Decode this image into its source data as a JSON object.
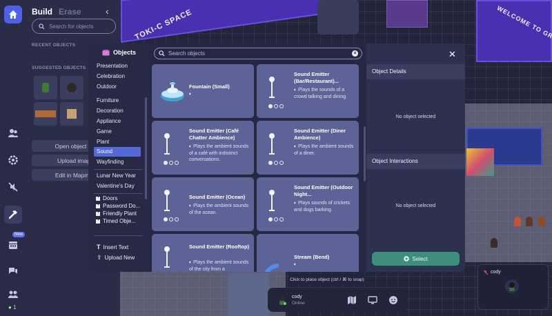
{
  "world": {
    "signs": [
      "TOKI-C SPACE",
      "WELCOME TO GROOVWORKS"
    ]
  },
  "build_panel": {
    "tabs": [
      "Build",
      "Erase"
    ],
    "search_placeholder": "Search for objects",
    "recent_heading": "RECENT OBJECTS",
    "suggested_heading": "SUGGESTED OBJECTS",
    "buttons": [
      "Open object pi",
      "Upload imag",
      "Edit in Mapma"
    ]
  },
  "rail": {
    "badge": "New",
    "online_count": "1"
  },
  "modal": {
    "title": "Objects",
    "search_placeholder": "Search objects",
    "categories": [
      "Presentation",
      "Celebration",
      "Outdoor",
      "Furniture",
      "Decoration",
      "Appliance",
      "Game",
      "Plant",
      "Sound",
      "Wayfinding",
      "Lunar New Year",
      "Valentine's Day"
    ],
    "active_category": "Sound",
    "subcategories": [
      "Doors",
      "Password Do...",
      "Friendly Plant",
      "Timed Obje..."
    ],
    "actions": [
      "Insert Text",
      "Upload New"
    ],
    "cards": [
      {
        "title": "Fountain (Small)",
        "description": ""
      },
      {
        "title": "Sound Emitter (Bar/Restaurant)...",
        "description": "Plays the sounds of a crowd talking and dining"
      },
      {
        "title": "Sound Emitter (Café Chatter Ambience)",
        "description": "Plays the ambient sounds of a café with indistinct conversations."
      },
      {
        "title": "Sound Emitter (Diner Ambience)",
        "description": "Plays the ambient sounds of a diner."
      },
      {
        "title": "Sound Emitter (Ocean)",
        "description": "Plays the ambient sounds of the ocean."
      },
      {
        "title": "Sound Emitter (Outdoor Night...",
        "description": "Plays sounds of crickets and dogs barking."
      },
      {
        "title": "Sound Emitter (Rooftop)",
        "description": "Plays the ambient sounds of the city from a"
      },
      {
        "title": "Stream (Bend)",
        "description": ""
      }
    ],
    "details": {
      "object_details_label": "Object Details",
      "object_details_empty": "No object selected",
      "object_interactions_label": "Object Interactions",
      "object_interactions_empty": "No object selected",
      "select_label": "Select"
    }
  },
  "hud": {
    "hint": "Click to place object (ctrl / ⌘ to snap)",
    "user_name": "cody",
    "user_status": "Online",
    "video_name": "cody"
  },
  "colors": {
    "accent": "#5468d8",
    "card": "#5e6397",
    "select": "#3d8f7c",
    "world_purple": "#4a2fb0"
  }
}
